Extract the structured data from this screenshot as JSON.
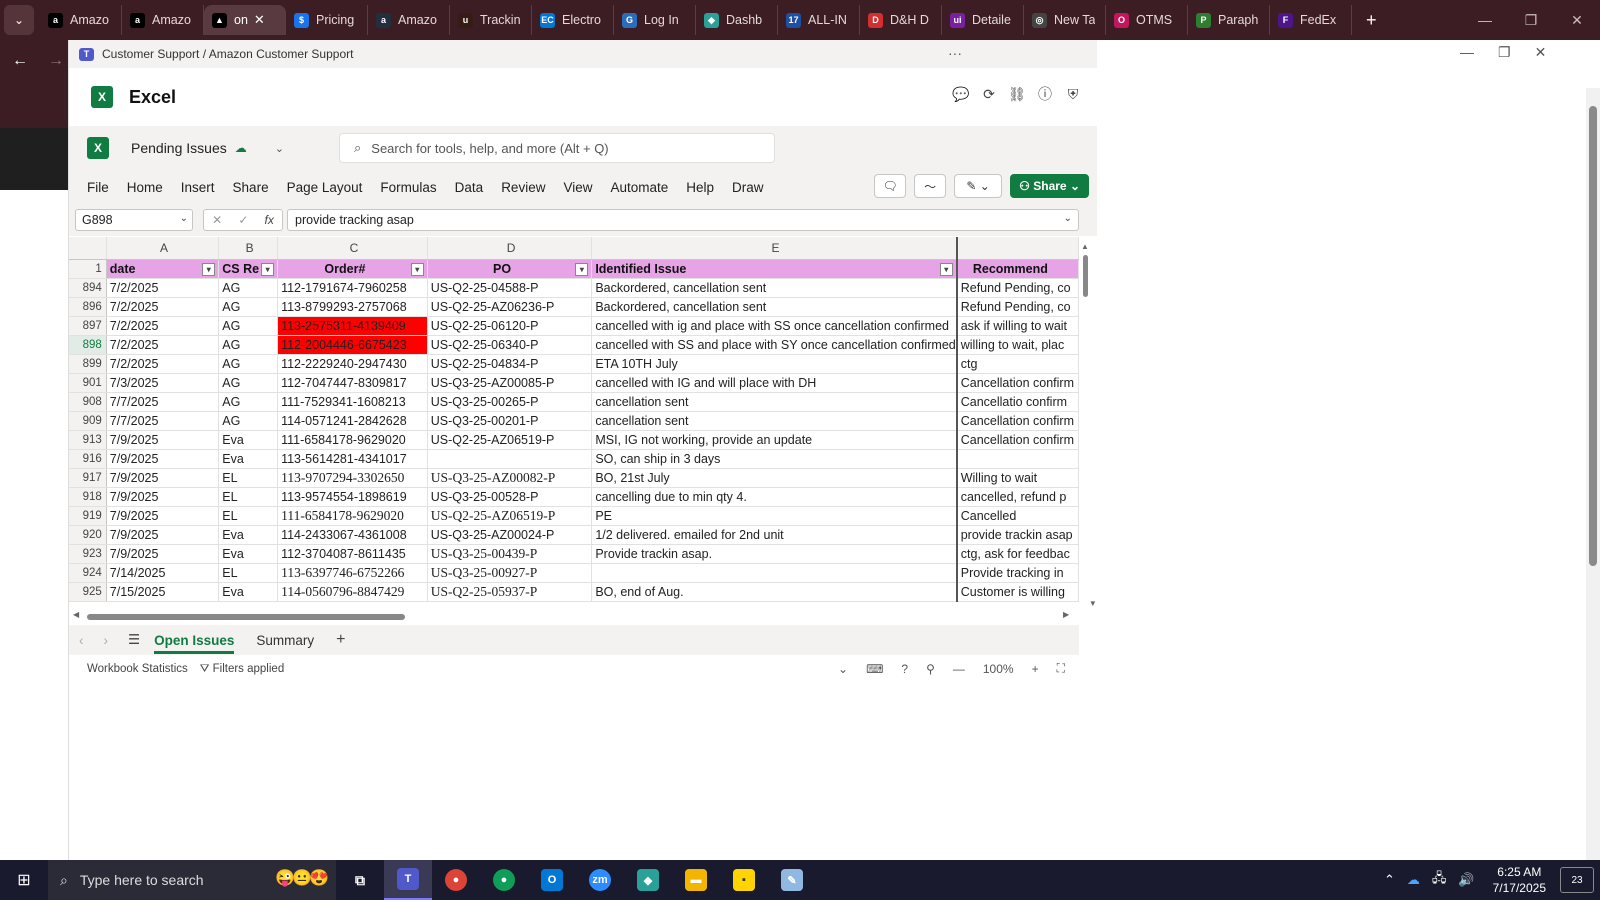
{
  "browser": {
    "tabs": [
      {
        "label": "Amazo",
        "icon": "amazon-icon",
        "color": "#000000",
        "glyph": "a"
      },
      {
        "label": "Amazo",
        "icon": "amazon-icon",
        "color": "#000000",
        "glyph": "a"
      },
      {
        "label": "on",
        "icon": "ai-icon",
        "color": "#000000",
        "glyph": "▲",
        "active": true
      },
      {
        "label": "Pricing",
        "icon": "dollar-icon",
        "color": "#1a73e8",
        "glyph": "$"
      },
      {
        "label": "Amazo",
        "icon": "amazon-icon",
        "color": "#232f3e",
        "glyph": "a"
      },
      {
        "label": "Trackin",
        "icon": "ups-icon",
        "color": "#351c15",
        "glyph": "u"
      },
      {
        "label": "Electro",
        "icon": "ec-icon",
        "color": "#0078d4",
        "glyph": "EC"
      },
      {
        "label": "Log In",
        "icon": "login-icon",
        "color": "#2a6ebb",
        "glyph": "G"
      },
      {
        "label": "Dashb",
        "icon": "dashboard-icon",
        "color": "#2aa198",
        "glyph": "◆"
      },
      {
        "label": "ALL-IN",
        "icon": "17track-icon",
        "color": "#1e4fa3",
        "glyph": "17"
      },
      {
        "label": "D&H D",
        "icon": "dh-icon",
        "color": "#d32f2f",
        "glyph": "D"
      },
      {
        "label": "Detaile",
        "icon": "detail-icon",
        "color": "#7b1fa2",
        "glyph": "ui"
      },
      {
        "label": "New Ta",
        "icon": "openai-icon",
        "color": "#444444",
        "glyph": "◎"
      },
      {
        "label": "OTMS",
        "icon": "otms-icon",
        "color": "#c2185b",
        "glyph": "O"
      },
      {
        "label": "Paraph",
        "icon": "paraphrase-icon",
        "color": "#2e7d32",
        "glyph": "P"
      },
      {
        "label": "FedEx",
        "icon": "fedex-icon",
        "color": "#4d148c",
        "glyph": "F"
      }
    ]
  },
  "popup": {
    "title": "Customer Support / Amazon Customer Support",
    "app_name": "Excel",
    "doc_name": "Pending Issues",
    "search_placeholder": "Search for tools, help, and more (Alt + Q)",
    "menu": [
      "File",
      "Home",
      "Insert",
      "Share",
      "Page Layout",
      "Formulas",
      "Data",
      "Review",
      "View",
      "Automate",
      "Help",
      "Draw"
    ],
    "share_label": "Share",
    "name_box": "G898",
    "formula": "provide tracking asap"
  },
  "grid": {
    "columns": [
      "A",
      "B",
      "C",
      "D",
      "E"
    ],
    "header_row_num": "1",
    "headers": [
      "date",
      "CS Re",
      "Order#",
      "PO",
      "Identified Issue",
      "Recommend"
    ],
    "rows": [
      {
        "n": "894",
        "date": "7/2/2025",
        "cs": "AG",
        "order": "112-1791674-7960258",
        "po": "US-Q2-25-04588-P",
        "issue": "Backordered, cancellation sent",
        "rec": "Refund Pending, co"
      },
      {
        "n": "896",
        "date": "7/2/2025",
        "cs": "AG",
        "order": "113-8799293-2757068",
        "po": "US-Q2-25-AZ06236-P",
        "issue": "Backordered, cancellation sent",
        "rec": "Refund Pending, co"
      },
      {
        "n": "897",
        "date": "7/2/2025",
        "cs": "AG",
        "order": "113-2575311-4139409",
        "po": "US-Q2-25-06120-P",
        "issue": "cancelled with ig and place with SS once cancellation confirmed",
        "rec": "ask if willing to wait",
        "red": true
      },
      {
        "n": "898",
        "date": "7/2/2025",
        "cs": "AG",
        "order": "112-2004446-6675423",
        "po": "US-Q2-25-06340-P",
        "issue": "cancelled with SS and place with SY once cancellation confirmed",
        "rec": "willing to wait, plac",
        "red": true,
        "sel": true
      },
      {
        "n": "899",
        "date": "7/2/2025",
        "cs": "AG",
        "order": "112-2229240-2947430",
        "po": "US-Q2-25-04834-P",
        "issue": "ETA 10TH July",
        "rec": "ctg"
      },
      {
        "n": "901",
        "date": "7/3/2025",
        "cs": "AG",
        "order": "112-7047447-8309817",
        "po": "US-Q3-25-AZ00085-P",
        "issue": "cancelled with IG and will place with DH",
        "rec": "Cancellation confirm"
      },
      {
        "n": "908",
        "date": "7/7/2025",
        "cs": "AG",
        "order": "111-7529341-1608213",
        "po": "US-Q3-25-00265-P",
        "issue": "cancellation sent",
        "rec": "Cancellatio confirm"
      },
      {
        "n": "909",
        "date": "7/7/2025",
        "cs": "AG",
        "order": "114-0571241-2842628",
        "po": "US-Q3-25-00201-P",
        "issue": "cancellation sent",
        "rec": "Cancellation confirm"
      },
      {
        "n": "913",
        "date": "7/9/2025",
        "cs": "Eva",
        "order": "111-6584178-9629020",
        "po": "US-Q2-25-AZ06519-P",
        "issue": "MSI, IG not working, provide an update",
        "rec": "Cancellation confirm"
      },
      {
        "n": "916",
        "date": "7/9/2025",
        "cs": "Eva",
        "order": "113-5614281-4341017",
        "po": "",
        "issue": "SO, can ship in 3 days",
        "rec": ""
      },
      {
        "n": "917",
        "date": "7/9/2025",
        "cs": "EL",
        "order": "113-9707294-3302650",
        "po": "US-Q3-25-AZ00082-P",
        "issue": "BO, 21st July",
        "rec": "Willing to wait",
        "serif": true
      },
      {
        "n": "918",
        "date": "7/9/2025",
        "cs": "EL",
        "order": "113-9574554-1898619",
        "po": "US-Q3-25-00528-P",
        "issue": "cancelling due to min qty 4.",
        "rec": "cancelled, refund p"
      },
      {
        "n": "919",
        "date": "7/9/2025",
        "cs": "EL",
        "order": "111-6584178-9629020",
        "po": "US-Q2-25-AZ06519-P",
        "issue": "PE",
        "rec": "Cancelled",
        "serif": true
      },
      {
        "n": "920",
        "date": "7/9/2025",
        "cs": "Eva",
        "order": "114-2433067-4361008",
        "po": "US-Q3-25-AZ00024-P",
        "issue": "1/2 delivered. emailed for 2nd unit",
        "rec": "provide trackin asap"
      },
      {
        "n": "923",
        "date": "7/9/2025",
        "cs": "Eva",
        "order": "112-3704087-8611435",
        "po": "US-Q3-25-00439-P",
        "issue": "Provide trackin asap.",
        "rec": "ctg, ask for feedbac",
        "serif_po": true
      },
      {
        "n": "924",
        "date": "7/14/2025",
        "cs": "EL",
        "order": "113-6397746-6752266",
        "po": "US-Q3-25-00927-P",
        "issue": "",
        "rec": "Provide tracking in",
        "serif": true
      },
      {
        "n": "925",
        "date": "7/15/2025",
        "cs": "Eva",
        "order": "114-0560796-8847429",
        "po": "US-Q2-25-05937-P",
        "issue": "BO, end of Aug.",
        "rec": "Customer is willing",
        "serif": true
      }
    ]
  },
  "sheets": {
    "tabs": [
      "Open Issues",
      "Summary"
    ],
    "active": "Open Issues"
  },
  "status": {
    "workbook_stats": "Workbook Statistics",
    "filters": "Filters applied",
    "zoom": "100%"
  },
  "taskbar": {
    "search_placeholder": "Type here to search",
    "time": "6:25 AM",
    "date": "7/17/2025",
    "notifications": "23"
  },
  "colors": {
    "excel_green": "#107c41",
    "header_fill": "#e6a3e6",
    "red_fill": "#ff0000",
    "browser_frame": "#3b1d23"
  }
}
